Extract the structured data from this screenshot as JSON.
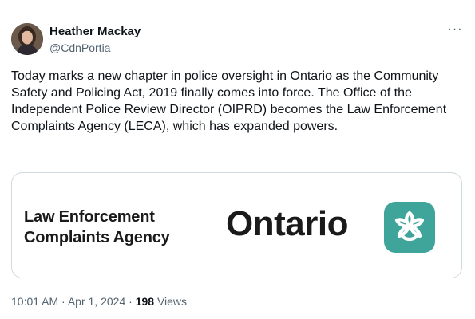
{
  "author": {
    "name": "Heather Mackay",
    "handle": "@CdnPortia"
  },
  "more_label": "···",
  "tweet": {
    "text": "Today marks a new chapter in police oversight in Ontario as the Community Safety and Policing Act, 2019 finally comes into force. The Office of the Independent Police Review Director (OIPRD) becomes the Law Enforcement Complaints Agency (LECA), which has expanded powers."
  },
  "media": {
    "agency_line1": "Law Enforcement",
    "agency_line2": "Complaints Agency",
    "ontario_wordmark": "Ontario",
    "logo_icon": "ontario-trillium-icon",
    "logo_color": "#3fa59a"
  },
  "footer": {
    "time": "10:01 AM",
    "date": "Apr 1, 2024",
    "separator": "·",
    "views_count": "198",
    "views_label": "Views"
  }
}
